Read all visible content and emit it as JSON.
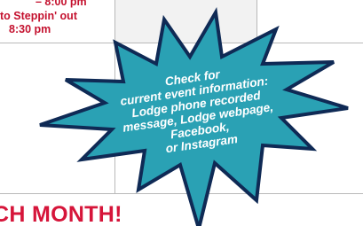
{
  "calendar": {
    "cell_lines": [
      "– 8:00 pm",
      "to Steppin' out",
      "8:30 pm"
    ],
    "footer_heading": "CH MONTH!"
  },
  "callout": {
    "lines": [
      "Check for",
      "current event information:",
      "Lodge phone recorded",
      "message, Lodge webpage,",
      "Facebook,",
      "or Instagram"
    ],
    "fill_color": "#2aa1b4",
    "stroke_color": "#0f2a55"
  }
}
